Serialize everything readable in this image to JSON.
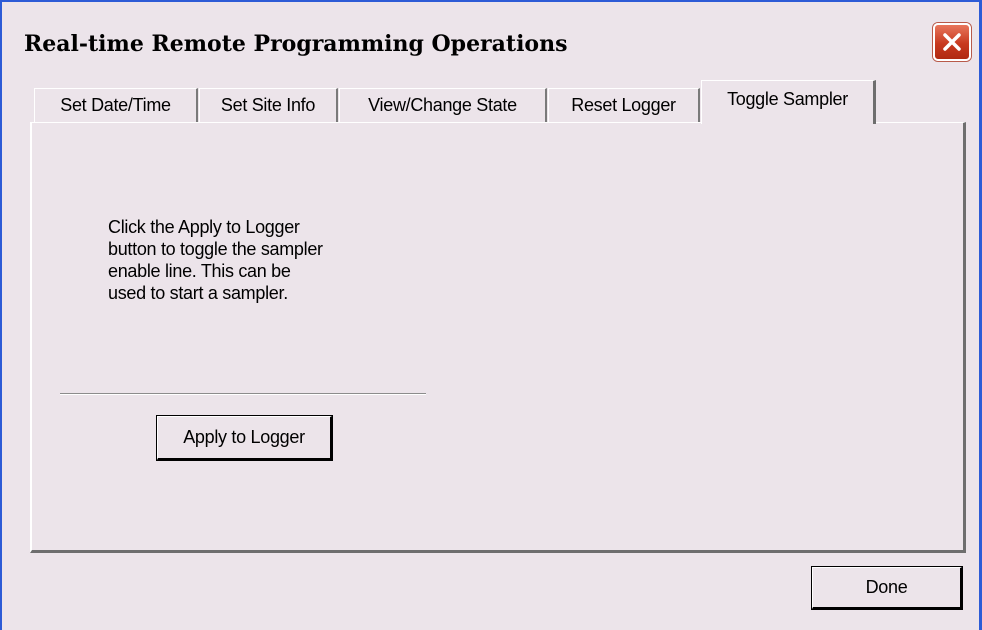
{
  "window": {
    "title": "Real-time Remote Programming Operations",
    "close_icon": "close-x-icon"
  },
  "tabs": [
    {
      "label": "Set Date/Time",
      "active": false
    },
    {
      "label": "Set Site Info",
      "active": false
    },
    {
      "label": "View/Change State",
      "active": false
    },
    {
      "label": "Reset Logger",
      "active": false
    },
    {
      "label": "Toggle Sampler",
      "active": true
    }
  ],
  "panel": {
    "description_lines": [
      "Click the Apply to Logger",
      "button to toggle the sampler",
      "enable line. This can be",
      "used to start a sampler."
    ],
    "apply_label": "Apply to Logger"
  },
  "footer": {
    "done_label": "Done"
  },
  "colors": {
    "title_bar_border": "#2d5bd6",
    "dialog_background": "#ece4ea",
    "close_button": "#c8391f"
  }
}
